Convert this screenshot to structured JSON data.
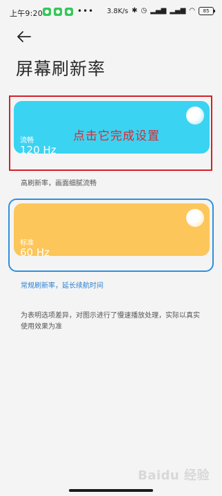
{
  "status_bar": {
    "time": "上午9:20",
    "more": "•••",
    "network_speed": "3.8K/s",
    "battery": "85"
  },
  "page": {
    "title": "屏幕刷新率"
  },
  "options": [
    {
      "name": "流畅",
      "rate": "120 Hz",
      "caption": "高刷新率，画面细腻流畅",
      "color": "#3bd3f2"
    },
    {
      "name": "标准",
      "rate": "60 Hz",
      "caption": "常规刷新率，延长续航时间",
      "color": "#fcc65a",
      "selected": true
    }
  ],
  "annotation": {
    "text": "点击它完成设置",
    "color": "#e0262c"
  },
  "note": "为表明选项差异，对图示进行了慢速播放处理，实际以真实使用效果为准",
  "watermark": "Baidu 经验",
  "colors": {
    "selected_ring": "#2e8fdd",
    "highlight_box": "#d32026"
  }
}
